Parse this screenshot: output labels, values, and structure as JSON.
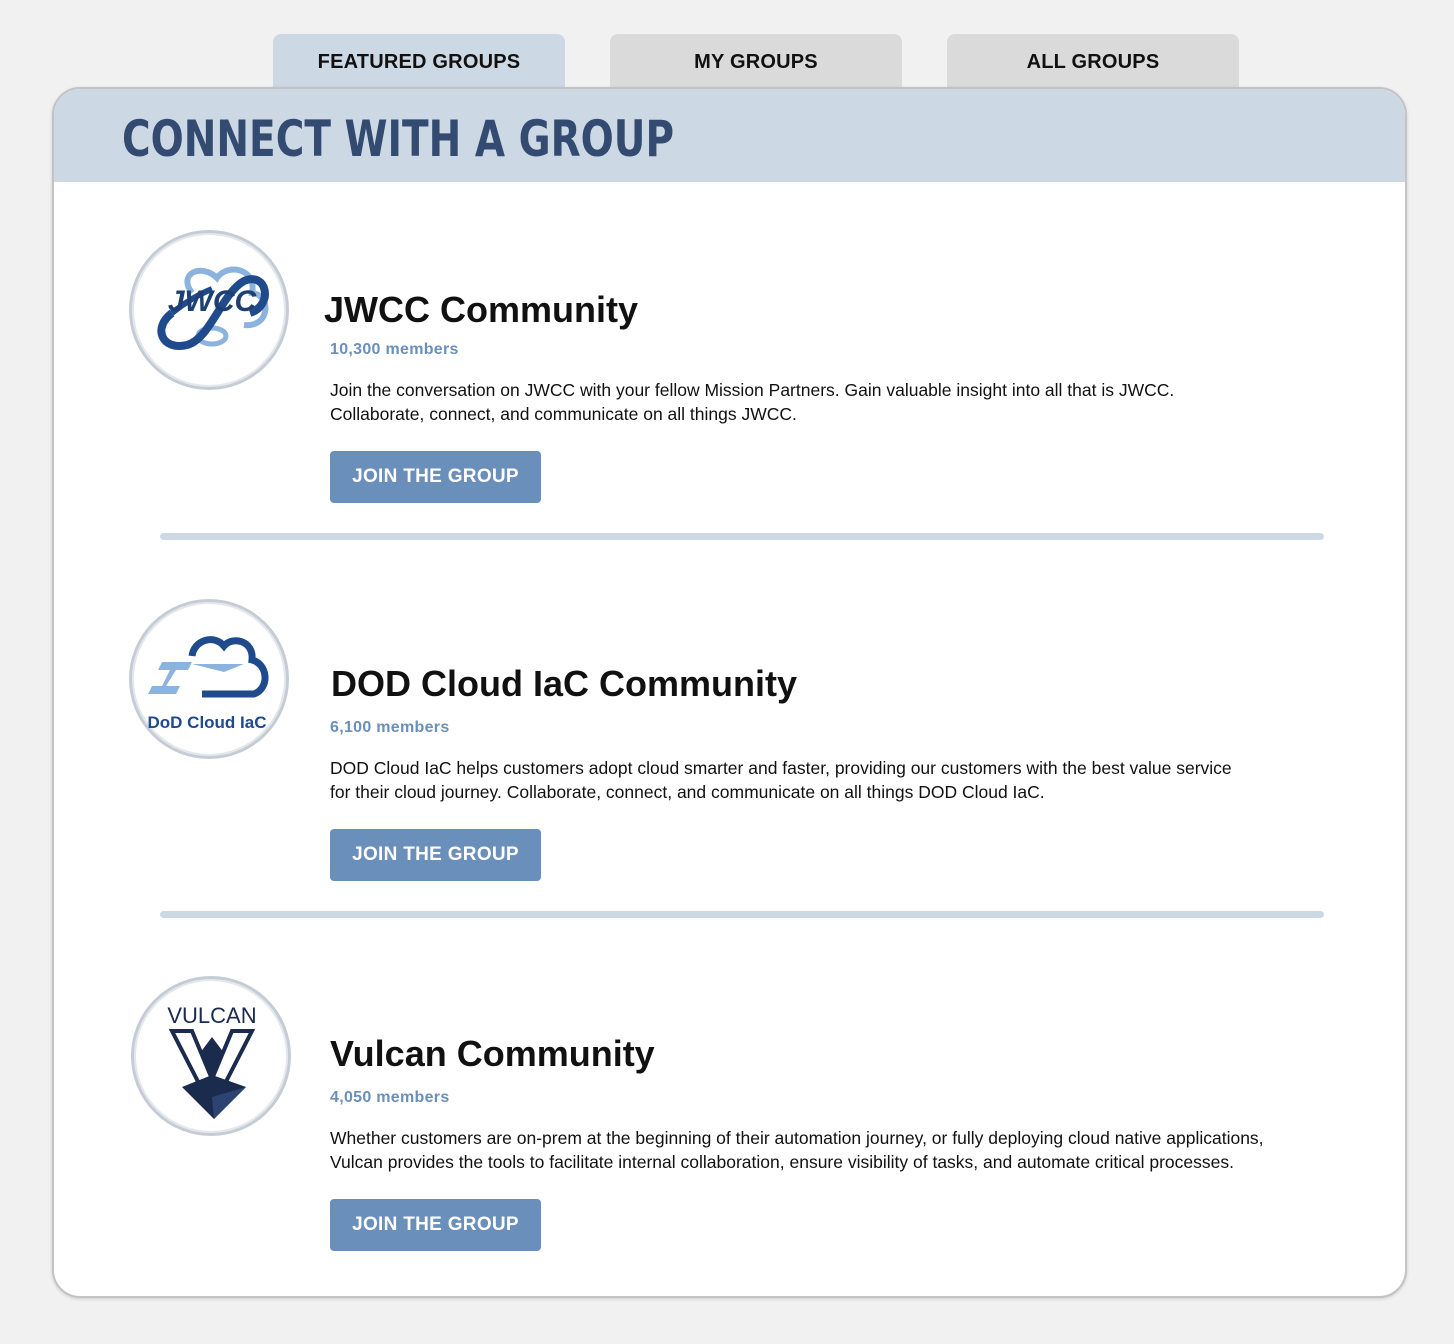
{
  "tabs": [
    {
      "label": "FEATURED GROUPS",
      "active": true
    },
    {
      "label": "MY GROUPS",
      "active": false
    },
    {
      "label": "ALL GROUPS",
      "active": false
    }
  ],
  "header": {
    "title": "CONNECT WITH A GROUP"
  },
  "groups": [
    {
      "name": "JWCC Community",
      "members": "10,300 members",
      "description_lines": [
        "Join the conversation on JWCC with your fellow Mission Partners. Gain valuable insight into all that is JWCC.",
        "Collaborate, connect, and communicate on all things JWCC."
      ],
      "button": "JOIN THE GROUP",
      "logo": {
        "icon": "jwcc-logo-icon",
        "text": "JWCC"
      }
    },
    {
      "name": "DOD Cloud IaC Community",
      "members": "6,100 members",
      "description_lines": [
        "DOD Cloud IaC helps customers adopt cloud smarter and faster, providing our customers with the best value service",
        "for their cloud journey. Collaborate, connect, and communicate on all things DOD Cloud IaC."
      ],
      "button": "JOIN THE GROUP",
      "logo": {
        "icon": "dod-cloud-iac-logo-icon",
        "text": "DoD Cloud IaC"
      }
    },
    {
      "name": "Vulcan Community",
      "members": "4,050 members",
      "description_lines": [
        "Whether customers are on-prem at the beginning of their automation journey, or fully deploying cloud native applications,",
        "Vulcan provides the tools to facilitate internal collaboration, ensure visibility of tasks, and automate critical processes."
      ],
      "button": "JOIN THE GROUP",
      "logo": {
        "icon": "vulcan-logo-icon",
        "text": "VULCAN"
      }
    }
  ],
  "colors": {
    "accent": "#6b8fbb",
    "header_bg": "#cdd8e5",
    "title": "#334b71",
    "inactive_tab": "#dadada"
  }
}
